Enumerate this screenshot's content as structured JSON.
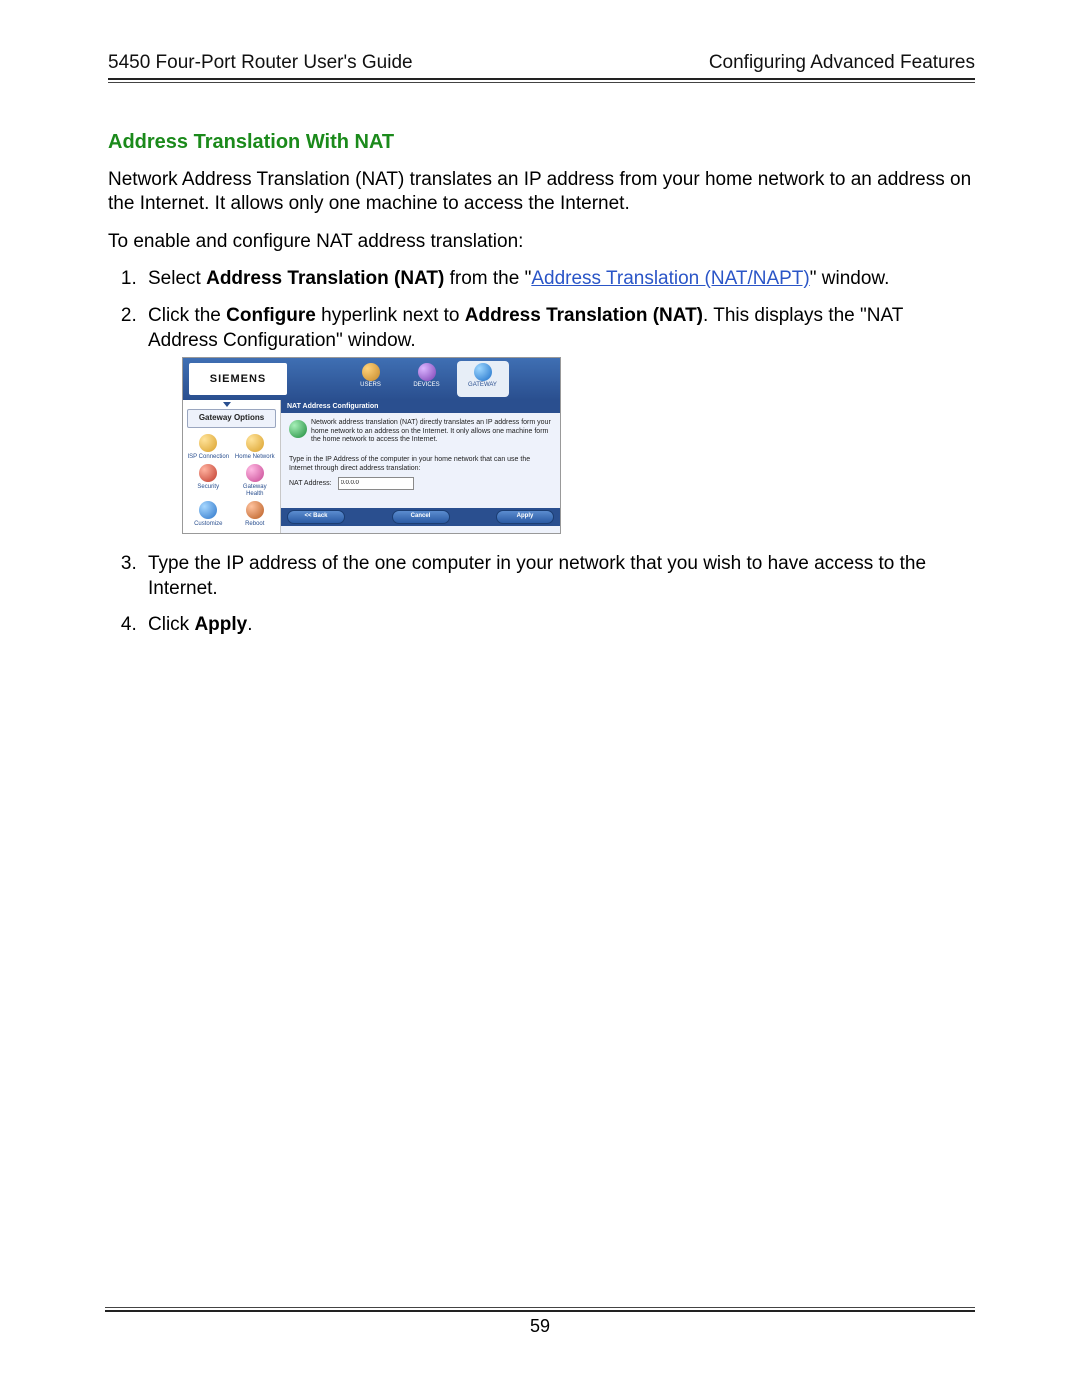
{
  "header": {
    "left": "5450 Four-Port Router User's Guide",
    "right": "Configuring Advanced Features"
  },
  "sectionTitle": "Address Translation With NAT",
  "intro": "Network Address Translation (NAT) translates an IP address from your home network to an address on the Internet. It allows only one machine to access the Internet.",
  "lead": "To enable and configure NAT address translation:",
  "steps": {
    "s1_a": "Select ",
    "s1_b": "Address Translation (NAT)",
    "s1_c": " from the \"",
    "s1_link": "Address Translation (NAT/NAPT)",
    "s1_d": "\" window.",
    "s2_a": "Click the ",
    "s2_b": "Configure",
    "s2_c": " hyperlink next to ",
    "s2_d": "Address Translation (NAT)",
    "s2_e": ". This displays the \"NAT Address Configuration\" window.",
    "s3": "Type the IP address of the one computer in your network that you wish to have access to the Internet.",
    "s4_a": "Click ",
    "s4_b": "Apply",
    "s4_c": "."
  },
  "shot": {
    "logo": "SIEMENS",
    "nav": {
      "users": "USERS",
      "devices": "DEVICES",
      "gateway": "GATEWAY"
    },
    "sideTitle": "Gateway Options",
    "sideItems": {
      "isp": "ISP Connection",
      "home": "Home Network",
      "security": "Security",
      "health": "Gateway Health",
      "customize": "Customize",
      "reboot": "Reboot"
    },
    "panelHeading": "NAT Address Configuration",
    "panelDesc": "Network address translation (NAT) directly translates an IP address form your home network to an address on the Internet. It only allows one machine form the home network to access the Internet.",
    "panelSub": "Type in the IP Address of the computer in your home network that can use the Internet through direct address translation:",
    "fieldLabel": "NAT Address:",
    "fieldValue": "0.0.0.0",
    "buttons": {
      "back": "<< Back",
      "cancel": "Cancel",
      "apply": "Apply"
    }
  },
  "pageNumber": "59"
}
